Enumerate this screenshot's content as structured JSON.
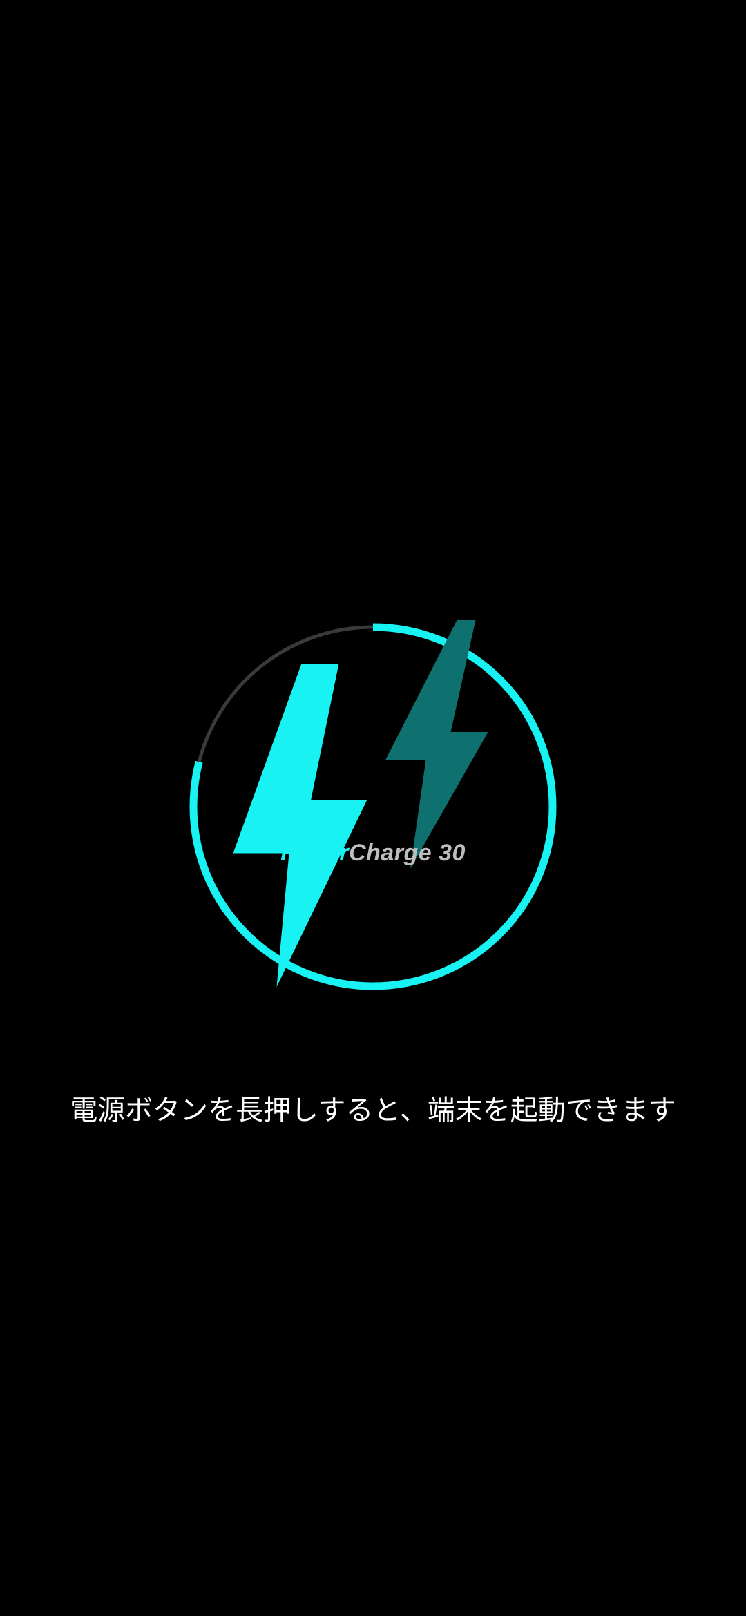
{
  "charging": {
    "progress_fraction": 0.79,
    "accent_color": "#19f2f2",
    "track_color": "#3a3a3a",
    "secondary_bolt_color": "#0f7070",
    "icon": "lightning-bolt-icon"
  },
  "brand": {
    "hyper": "Hyper",
    "charge": "Charge 30"
  },
  "message": "電源ボタンを長押しすると、端末を起動できます"
}
